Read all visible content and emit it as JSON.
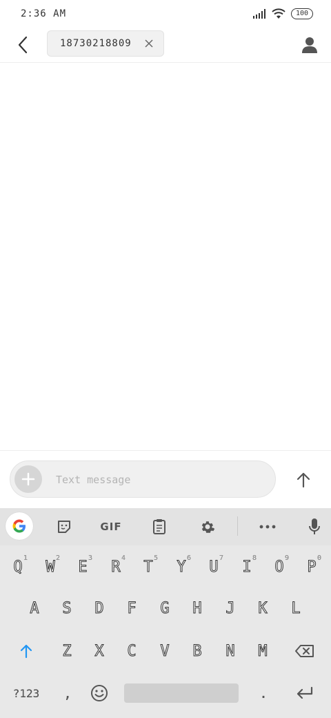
{
  "status_bar": {
    "time": "2:36 AM",
    "battery": "100"
  },
  "header": {
    "recipient": "18730218809"
  },
  "compose": {
    "placeholder": "Text message"
  },
  "keyboard": {
    "toolbar": {
      "gif_label": "GIF"
    },
    "row1": [
      {
        "key": "Q",
        "hint": "1"
      },
      {
        "key": "W",
        "hint": "2"
      },
      {
        "key": "E",
        "hint": "3"
      },
      {
        "key": "R",
        "hint": "4"
      },
      {
        "key": "T",
        "hint": "5"
      },
      {
        "key": "Y",
        "hint": "6"
      },
      {
        "key": "U",
        "hint": "7"
      },
      {
        "key": "I",
        "hint": "8"
      },
      {
        "key": "O",
        "hint": "9"
      },
      {
        "key": "P",
        "hint": "0"
      }
    ],
    "row2": [
      "A",
      "S",
      "D",
      "F",
      "G",
      "H",
      "J",
      "K",
      "L"
    ],
    "row3": [
      "Z",
      "X",
      "C",
      "V",
      "B",
      "N",
      "M"
    ],
    "symbols_key": "?123",
    "comma_key": ",",
    "period_key": "."
  },
  "colors": {
    "accent": "#1a73e8",
    "shift_active": "#2196f3"
  }
}
